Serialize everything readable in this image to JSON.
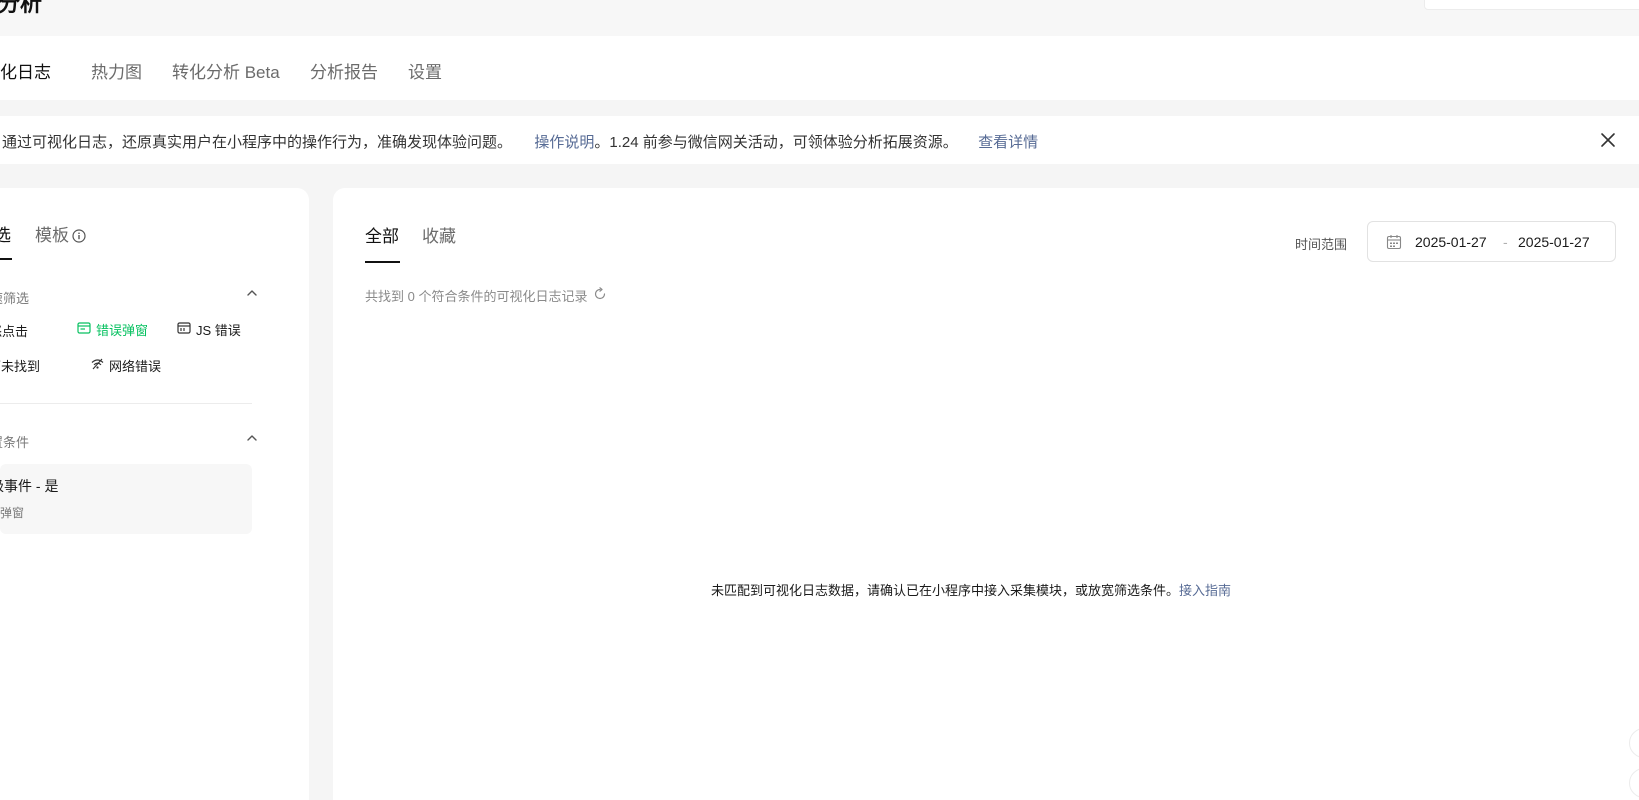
{
  "header": {
    "title": "分析"
  },
  "nav": {
    "items": [
      {
        "label": "可视化日志",
        "active": true
      },
      {
        "label": "热力图",
        "active": false
      },
      {
        "label": "转化分析 Beta",
        "active": false
      },
      {
        "label": "分析报告",
        "active": false
      },
      {
        "label": "设置",
        "active": false
      }
    ]
  },
  "notice": {
    "text1": "通过可视化日志，还原真实用户在小程序中的操作行为，准确发现体验问题。",
    "link1": "操作说明",
    "text2": "。1.24 前参与微信网关活动，可领体验分析拓展资源。",
    "link2": "查看详情"
  },
  "left_panel": {
    "tabs": [
      {
        "label": "筛选",
        "active": true
      },
      {
        "label": "模板",
        "active": false
      }
    ],
    "quick_filter": {
      "title": "快速筛选",
      "chips": [
        {
          "label": "愤怒点击",
          "icon": "angry-click-icon",
          "selected": false
        },
        {
          "label": "错误弹窗",
          "icon": "error-popup-icon",
          "selected": true
        },
        {
          "label": "JS 错误",
          "icon": "js-error-icon",
          "selected": false
        },
        {
          "label": "页面未找到",
          "icon": "page-not-found-icon",
          "selected": false
        },
        {
          "label": "网络错误",
          "icon": "network-error-icon",
          "selected": false
        }
      ]
    },
    "conditions": {
      "title": "设置条件",
      "card_main": "消极事件 - 是",
      "card_sub": "错误弹窗"
    }
  },
  "main_panel": {
    "tabs": [
      {
        "label": "全部",
        "active": true
      },
      {
        "label": "收藏",
        "active": false
      }
    ],
    "range_label": "时间范围",
    "date_start": "2025-01-27",
    "date_sep": "-",
    "date_end": "2025-01-27",
    "result_count": "共找到 0 个符合条件的可视化日志记录",
    "empty_text": "未匹配到可视化日志数据，请确认已在小程序中接入采集模块，或放宽筛选条件。",
    "empty_link": "接入指南"
  },
  "colors": {
    "accent_green": "#07c160",
    "link_blue": "#576b95"
  }
}
